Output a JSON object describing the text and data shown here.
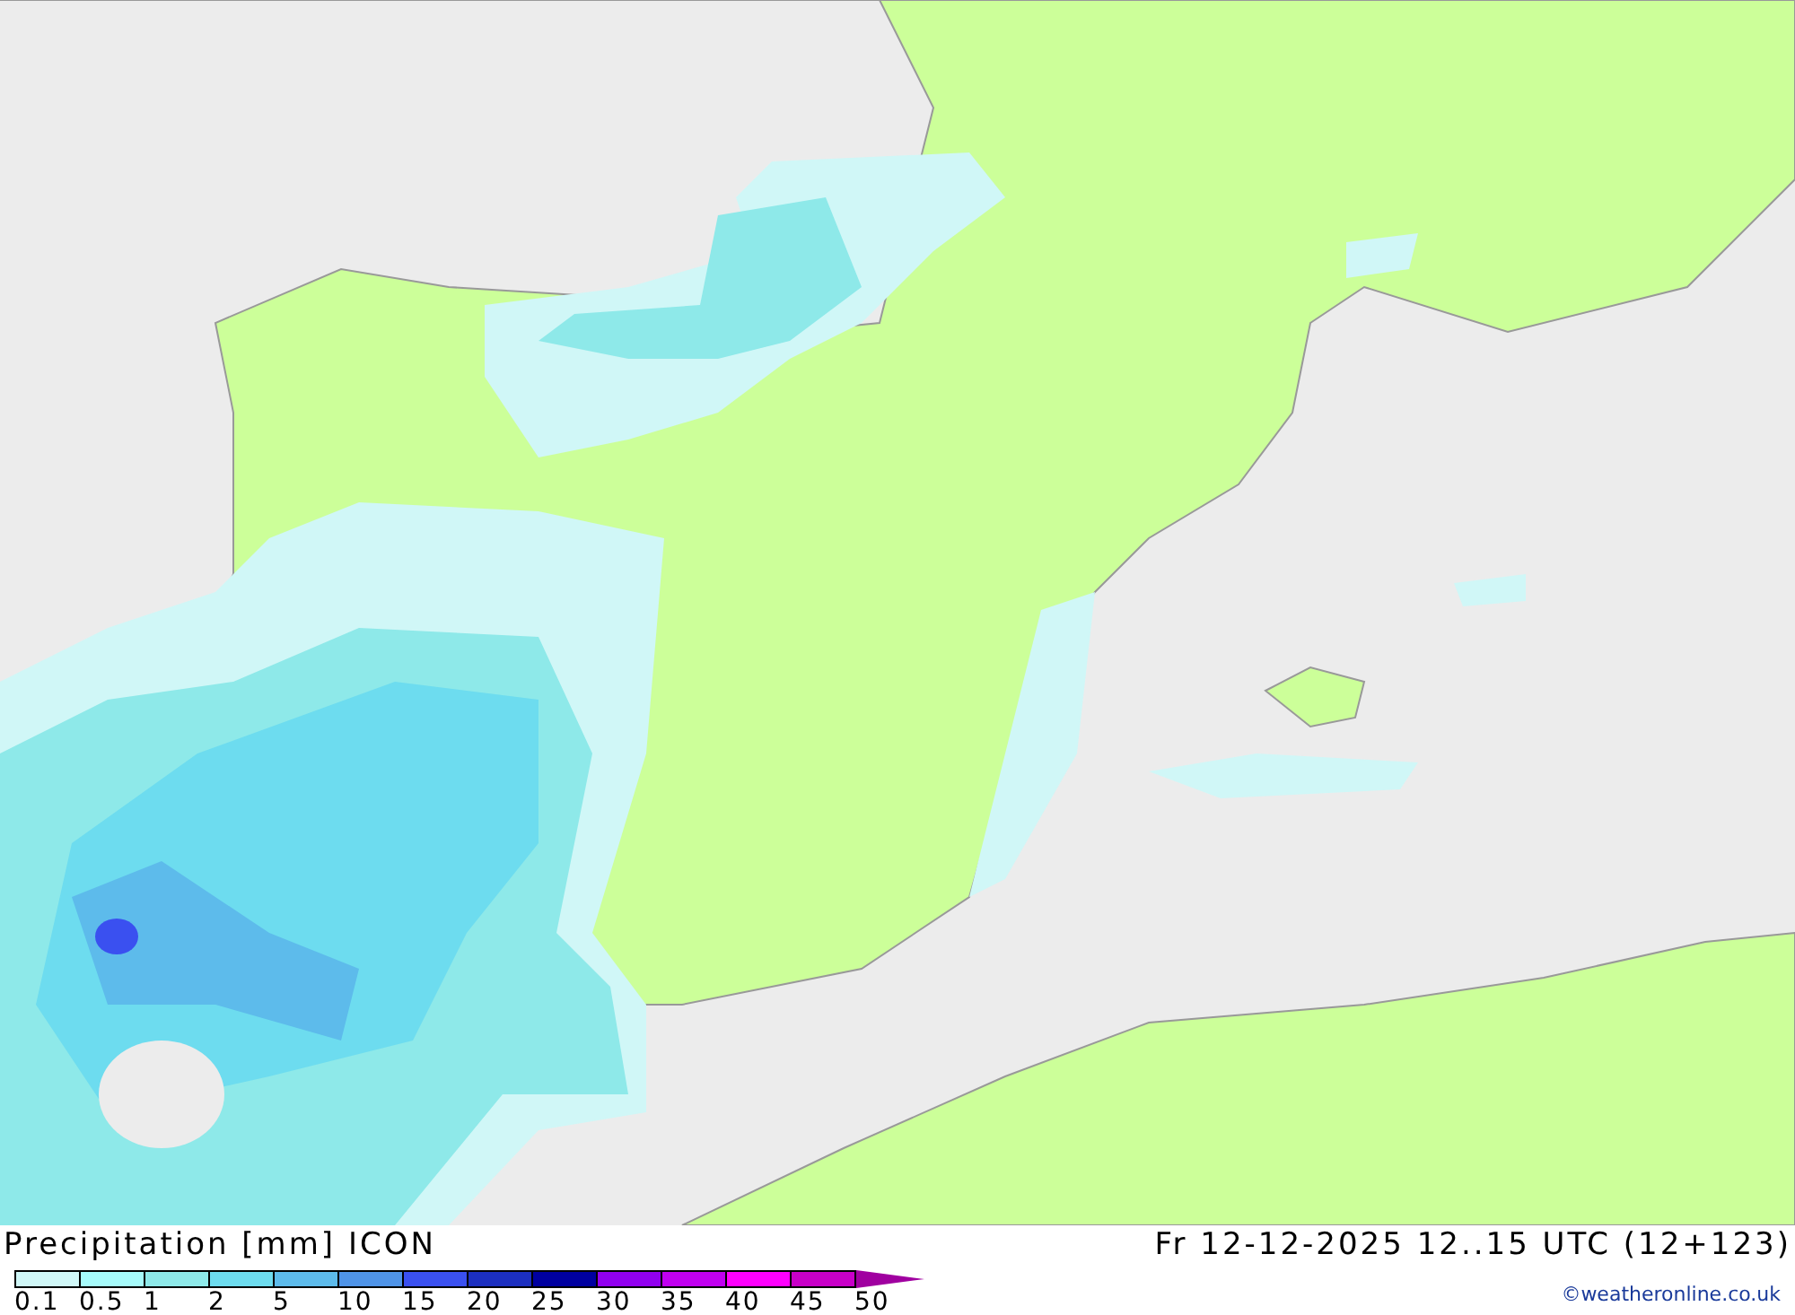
{
  "title": "Precipitation [mm] ICON",
  "valid_time": "Fr 12-12-2025 12..15 UTC (12+123)",
  "legend": {
    "bins": [
      {
        "color": "#d0f7f7"
      },
      {
        "color": "#a6fbfb"
      },
      {
        "color": "#8ee9e9"
      },
      {
        "color": "#6ddcef"
      },
      {
        "color": "#5dbbeb"
      },
      {
        "color": "#4f94e8"
      },
      {
        "color": "#3a50f0"
      },
      {
        "color": "#1c2fc0"
      },
      {
        "color": "#0000a0"
      },
      {
        "color": "#9100f0"
      },
      {
        "color": "#c000f0"
      },
      {
        "color": "#ff00ff"
      },
      {
        "color": "#c800c8"
      }
    ],
    "ticks": [
      "0.1",
      "0.5",
      "1",
      "2",
      "5",
      "10",
      "15",
      "20",
      "25",
      "30",
      "35",
      "40",
      "45",
      "50"
    ]
  },
  "credit": "©weatheronline.co.uk"
}
